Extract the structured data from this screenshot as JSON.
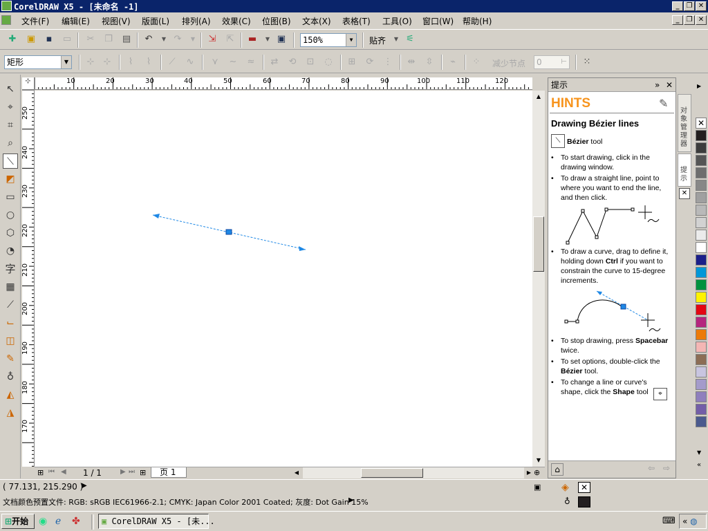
{
  "window": {
    "title": "CorelDRAW X5 - [未命名 -1]"
  },
  "menubar": {
    "items": [
      "文件(F)",
      "编辑(E)",
      "视图(V)",
      "版面(L)",
      "排列(A)",
      "效果(C)",
      "位图(B)",
      "文本(X)",
      "表格(T)",
      "工具(O)",
      "窗口(W)",
      "帮助(H)"
    ]
  },
  "toolbar1": {
    "zoom_value": "150%",
    "snap_label": "贴齐"
  },
  "toolbar2": {
    "object_type": "矩形",
    "reduce_nodes_label": "减少节点",
    "reduce_nodes_value": "0"
  },
  "ruler": {
    "top_ticks": [
      "10",
      "20",
      "30",
      "40",
      "50",
      "60",
      "70",
      "80",
      "90",
      "100",
      "110",
      "120"
    ],
    "left_ticks": [
      "250",
      "240",
      "230",
      "220",
      "210",
      "200",
      "190",
      "180",
      "170"
    ]
  },
  "navigator": {
    "page_count": "1 / 1",
    "page_tab": "页 1"
  },
  "docker": {
    "header": "提示",
    "hints_title": "HINTS",
    "heading": "Drawing Bézier lines",
    "tool_name": "Bézier",
    "tool_suffix": " tool",
    "bullets": {
      "b1": "To start drawing, click in the drawing window.",
      "b2": "To draw a straight line, point to where you want to end the line, and then click.",
      "b3a": "To draw a curve, drag to define it, holding down ",
      "b3key": "Ctrl",
      "b3b": " if you want to constrain the curve to 15-degree increments.",
      "b4a": "To stop drawing, press ",
      "b4key": "Spacebar",
      "b4b": " twice.",
      "b5a": "To set options, double-click the ",
      "b5key": "Bézier",
      "b5b": " tool.",
      "b6a": "To change a line or curve's shape, click the ",
      "b6key": "Shape",
      "b6b": " tool"
    }
  },
  "side_tabs": {
    "tab1": "对象管理器",
    "tab2": "提示"
  },
  "palette": {
    "colors": [
      "#231f20",
      "#3c3c3c",
      "#555555",
      "#6e6e6e",
      "#878787",
      "#a0a0a0",
      "#b9b9b9",
      "#d2d2d2",
      "#ebebeb",
      "#ffffff",
      "#1b1f8a",
      "#0097d8",
      "#00923f",
      "#fff200",
      "#e30613",
      "#b5247e",
      "#ec7a08",
      "#f4b6b4",
      "#8c6d55",
      "#c8c5e0",
      "#a49bcb",
      "#8f7fbd",
      "#735ea8",
      "#4b5a8e"
    ]
  },
  "status": {
    "coords": "( 77.131, 215.290 )",
    "color_profile": "文档颜色预置文件: RGB: sRGB IEC61966-2.1; CMYK: Japan Color 2001 Coated; 灰度: Dot Gain 15%"
  },
  "taskbar": {
    "start_label": "开始",
    "task_label": "CorelDRAW X5 - [未..."
  }
}
